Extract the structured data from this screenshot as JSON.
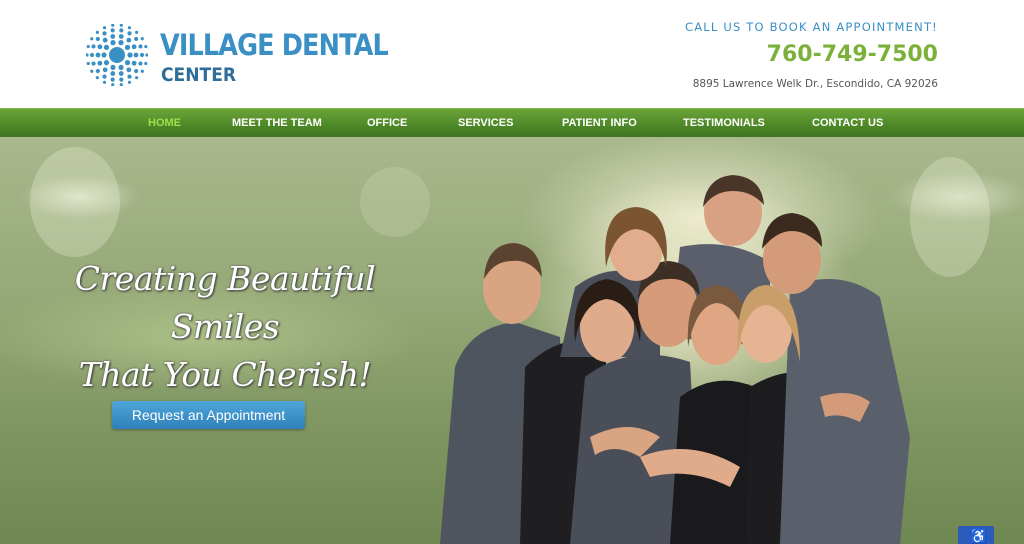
{
  "brand": {
    "name_line1": "VILLAGE DENTAL",
    "name_line2": "CENTER",
    "logo_icon": "sunburst-dots-logo",
    "colors": {
      "blue": "#3a8fc4",
      "green": "#7bb13b",
      "nav_green": "#4f8a28"
    }
  },
  "contact": {
    "cta": "CALL US TO BOOK AN APPOINTMENT!",
    "phone": "760-749-7500",
    "address": "8895 Lawrence Welk Dr., Escondido, CA 92026"
  },
  "nav": {
    "items": [
      {
        "label": "HOME",
        "active": true
      },
      {
        "label": "MEET THE TEAM"
      },
      {
        "label": "OFFICE"
      },
      {
        "label": "SERVICES"
      },
      {
        "label": "PATIENT INFO"
      },
      {
        "label": "TESTIMONIALS"
      },
      {
        "label": "CONTACT US"
      }
    ]
  },
  "hero": {
    "headline_line1": "Creating Beautiful Smiles",
    "headline_line2": "That You Cherish!",
    "button_label": "Request an Appointment",
    "photo": "family-group-photo"
  },
  "accessibility": {
    "icon": "accessibility-icon"
  }
}
